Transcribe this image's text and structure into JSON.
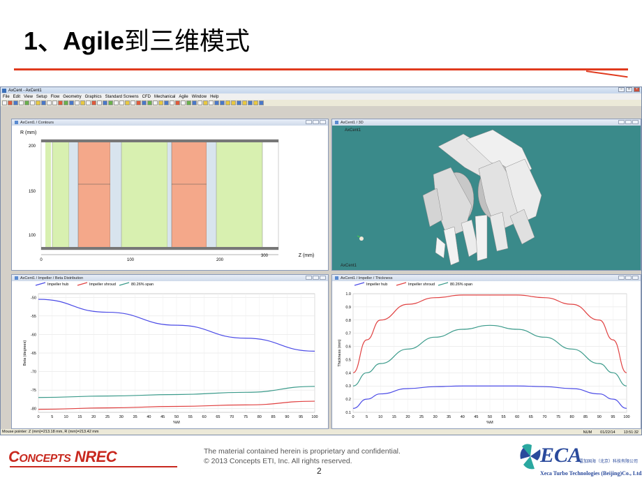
{
  "slide": {
    "title_num": "1、",
    "title_bold": "Agile",
    "title_rest": "到三维模式",
    "page_number": "2",
    "footer_line1": "The material contained herein is proprietary and confidential.",
    "footer_line2": "© 2013 Concepts ETI,  Inc. All rights reserved.",
    "left_logo_big1": "C",
    "left_logo_small1": "ONCEPTS",
    "left_logo_big2": " NREC",
    "right_logo_text": "ECA",
    "right_logo_cn": "雷加国海（北京）科技有限公司",
    "right_logo_en": "Xeca Turbo Technologies (Beijing)Co., Ltd."
  },
  "app": {
    "window_title": "AxCent - AxCent1",
    "menu": [
      "File",
      "Edit",
      "View",
      "Setup",
      "Flow",
      "Geometry",
      "Graphics",
      "Standard Screens",
      "CFD",
      "Mechanical",
      "Agile",
      "Window",
      "Help"
    ],
    "status_left": "Mouse pointer: Z (mm)=213.18 mm, R (mm)=213.42 mm",
    "status_num": "NUM",
    "status_date": "01/22/14",
    "status_time": "13:51:32",
    "colors": {
      "hub": "#4a4ae6",
      "shroud": "#e04040",
      "span": "#3a9a8a",
      "green_zone": "#d8f0b0",
      "orange_zone": "#f4a88a",
      "viewport": "#3a8a8a"
    }
  },
  "panels": {
    "contours": {
      "title": "AxCent1 / Contours",
      "ylabel": "R (mm)",
      "xlabel": "Z (mm)",
      "yticks": [
        "200",
        "150",
        "100"
      ],
      "xticks": [
        "0",
        "100",
        "200",
        "300"
      ]
    },
    "view3d": {
      "title": "AxCent1 / 3D",
      "label_top": "AxCent1",
      "label_bottom": "AxCent1"
    },
    "beta": {
      "title": "AxCent1 / Impeller / Beta Distribution",
      "legend": [
        "Impeller hub",
        "Impeller shroud",
        "80.26% span"
      ],
      "ylabel": "Beta (degrees)",
      "xlabel": "%M",
      "yticks": [
        "-50",
        "-55",
        "-60",
        "-65",
        "-70",
        "-75",
        "-80"
      ],
      "xticks": [
        "0",
        "5",
        "10",
        "15",
        "20",
        "25",
        "30",
        "35",
        "40",
        "45",
        "50",
        "55",
        "60",
        "65",
        "70",
        "75",
        "80",
        "85",
        "90",
        "95",
        "100"
      ]
    },
    "thickness": {
      "title": "AxCent1 / Impeller / Thickness",
      "legend": [
        "Impeller hub",
        "Impeller shroud",
        "80.26% span"
      ],
      "ylabel": "Thickness (mm)",
      "xlabel": "%M",
      "yticks": [
        "1.0",
        "0.9",
        "0.8",
        "0.7",
        "0.6",
        "0.5",
        "0.4",
        "0.3",
        "0.2",
        "0.1"
      ],
      "xticks": [
        "0",
        "5",
        "10",
        "15",
        "20",
        "25",
        "30",
        "35",
        "40",
        "45",
        "50",
        "55",
        "60",
        "65",
        "70",
        "75",
        "80",
        "85",
        "90",
        "95",
        "100"
      ]
    }
  },
  "chart_data": [
    {
      "type": "line",
      "title": "AxCent1 / Impeller / Beta Distribution",
      "xlabel": "%M",
      "ylabel": "Beta (degrees)",
      "xlim": [
        0,
        100
      ],
      "ylim": [
        -81,
        -49
      ],
      "x": [
        0,
        25,
        50,
        75,
        100
      ],
      "series": [
        {
          "name": "Impeller hub",
          "values": [
            -50.5,
            -54,
            -57.5,
            -61,
            -64.5
          ]
        },
        {
          "name": "Impeller shroud",
          "values": [
            -80.2,
            -79.8,
            -79.4,
            -79,
            -78
          ]
        },
        {
          "name": "80.26% span",
          "values": [
            -77,
            -76.6,
            -76.2,
            -75.6,
            -74
          ]
        }
      ]
    },
    {
      "type": "line",
      "title": "AxCent1 / Impeller / Thickness",
      "xlabel": "%M",
      "ylabel": "Thickness (mm)",
      "xlim": [
        0,
        100
      ],
      "ylim": [
        0.1,
        1.0
      ],
      "x": [
        0,
        5,
        10,
        20,
        30,
        40,
        50,
        60,
        70,
        80,
        90,
        95,
        100
      ],
      "series": [
        {
          "name": "Impeller hub",
          "values": [
            0.13,
            0.2,
            0.24,
            0.28,
            0.295,
            0.3,
            0.3,
            0.3,
            0.295,
            0.28,
            0.24,
            0.2,
            0.13
          ]
        },
        {
          "name": "Impeller shroud",
          "values": [
            0.4,
            0.65,
            0.8,
            0.92,
            0.97,
            0.99,
            0.99,
            0.99,
            0.97,
            0.92,
            0.8,
            0.65,
            0.4
          ]
        },
        {
          "name": "80.26% span",
          "values": [
            0.3,
            0.4,
            0.47,
            0.58,
            0.67,
            0.73,
            0.76,
            0.73,
            0.67,
            0.58,
            0.47,
            0.4,
            0.3
          ]
        }
      ]
    }
  ]
}
